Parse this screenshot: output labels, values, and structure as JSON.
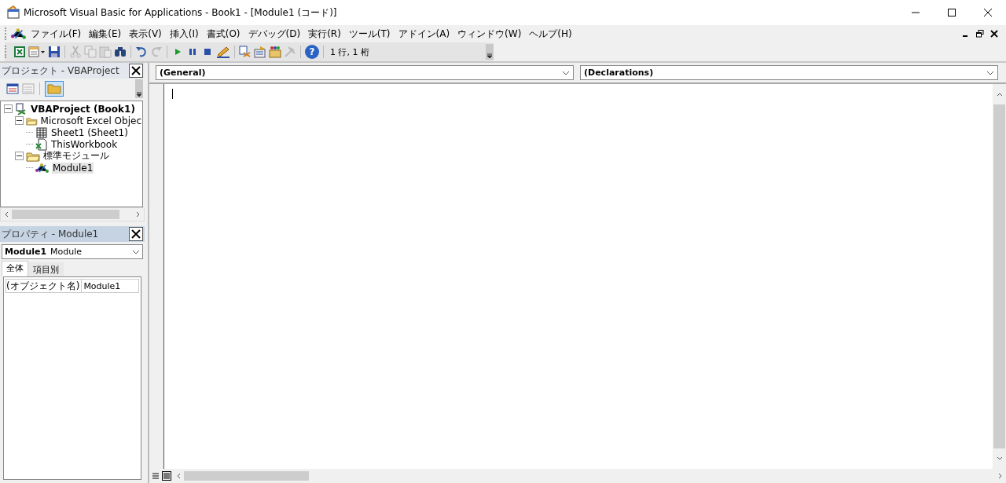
{
  "window": {
    "title": "Microsoft Visual Basic for Applications - Book1 - [Module1 (コード)]"
  },
  "menu": [
    "ファイル(F)",
    "編集(E)",
    "表示(V)",
    "挿入(I)",
    "書式(O)",
    "デバッグ(D)",
    "実行(R)",
    "ツール(T)",
    "アドイン(A)",
    "ウィンドウ(W)",
    "ヘルプ(H)"
  ],
  "toolbar": {
    "buttons": [
      {
        "kind": "excel",
        "disabled": false
      },
      {
        "kind": "insert",
        "disabled": false
      },
      {
        "kind": "save",
        "disabled": false
      },
      {
        "kind": "cut",
        "disabled": true
      },
      {
        "kind": "copy",
        "disabled": true
      },
      {
        "kind": "paste",
        "disabled": true
      },
      {
        "kind": "find",
        "disabled": false
      },
      {
        "kind": "undo",
        "disabled": false
      },
      {
        "kind": "redo",
        "disabled": true
      },
      {
        "kind": "run",
        "disabled": false
      },
      {
        "kind": "pause",
        "disabled": false
      },
      {
        "kind": "stop",
        "disabled": false
      },
      {
        "kind": "design",
        "disabled": false
      },
      {
        "kind": "explorer",
        "disabled": false
      },
      {
        "kind": "properties",
        "disabled": false
      },
      {
        "kind": "browser",
        "disabled": false
      },
      {
        "kind": "toolbox",
        "disabled": true
      },
      {
        "kind": "help",
        "disabled": false,
        "label": "?"
      }
    ],
    "position": "1 行, 1 桁"
  },
  "project": {
    "title": "プロジェクト - VBAProject",
    "tree": [
      {
        "label": "VBAProject (Book1)",
        "kind": "project",
        "expanded": true,
        "selected": false,
        "children": [
          {
            "label": "Microsoft Excel Objec",
            "kind": "folder",
            "expanded": true,
            "selected": false,
            "children": [
              {
                "label": "Sheet1 (Sheet1)",
                "kind": "sheet",
                "selected": false
              },
              {
                "label": "ThisWorkbook",
                "kind": "workbook",
                "selected": false
              }
            ]
          },
          {
            "label": "標準モジュール",
            "kind": "folder",
            "expanded": true,
            "selected": false,
            "children": [
              {
                "label": "Module1",
                "kind": "module",
                "selected": true
              }
            ]
          }
        ]
      }
    ]
  },
  "properties": {
    "title": "プロパティ - Module1",
    "object": {
      "name": "Module1",
      "type": "Module"
    },
    "tabs": [
      {
        "label": "全体",
        "selected": true
      },
      {
        "label": "項目別",
        "selected": false
      }
    ],
    "rows": [
      {
        "name": "(オブジェクト名)",
        "value": "Module1"
      }
    ]
  },
  "code": {
    "object": "(General)",
    "procedure": "(Declarations)"
  }
}
